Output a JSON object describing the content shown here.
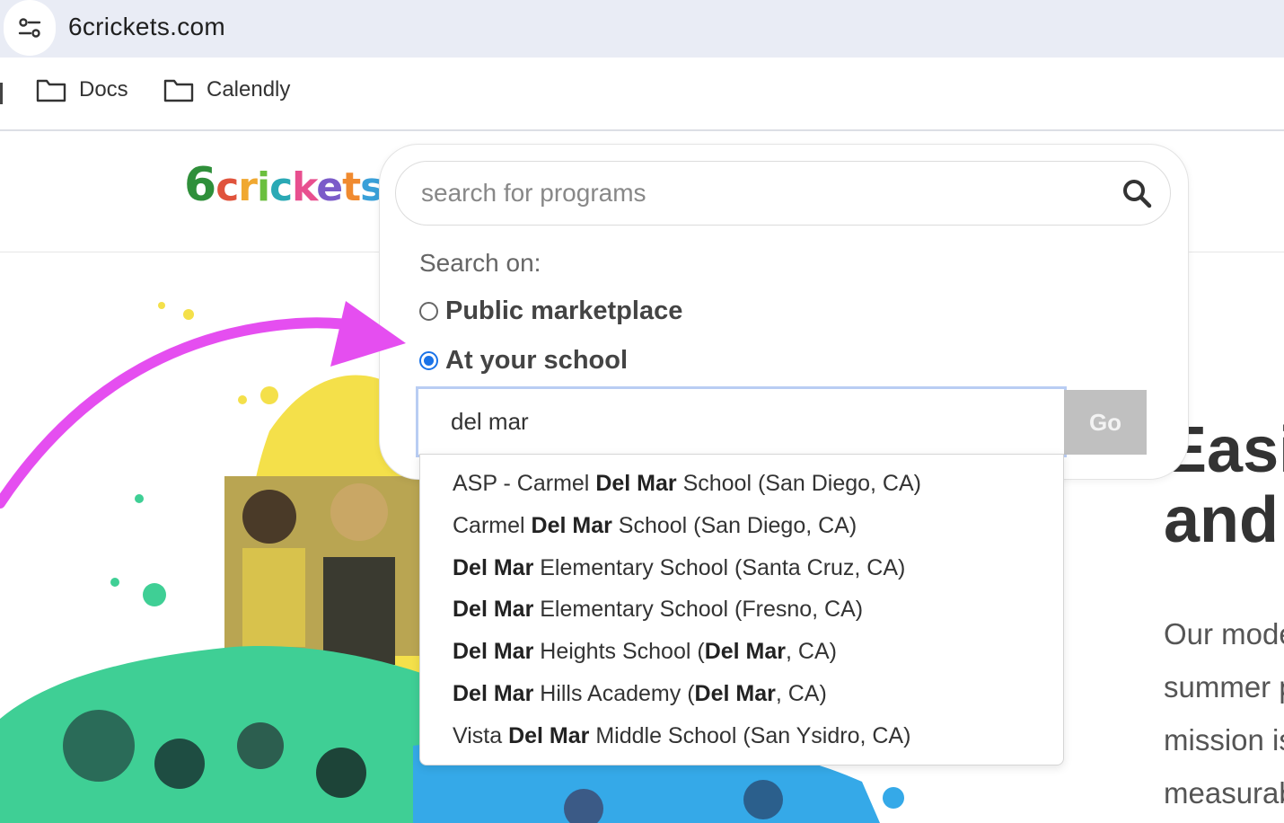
{
  "browser": {
    "url": "6crickets.com",
    "bookmarks": [
      {
        "label": "Docs"
      },
      {
        "label": "Calendly"
      }
    ]
  },
  "site": {
    "logo_text": "6crickets",
    "search": {
      "placeholder": "search for programs",
      "search_on_label": "Search on:",
      "options": [
        {
          "label": "Public marketplace",
          "checked": false
        },
        {
          "label": "At your school",
          "checked": true
        }
      ],
      "school_query": "del mar",
      "go_label": "Go",
      "suggestions": [
        {
          "pre": "ASP - Carmel ",
          "match": "Del Mar",
          "post": " School (San Diego, CA)",
          "match2": "",
          "post2": ""
        },
        {
          "pre": "Carmel ",
          "match": "Del Mar",
          "post": " School (San Diego, CA)",
          "match2": "",
          "post2": ""
        },
        {
          "pre": "",
          "match": "Del Mar",
          "post": " Elementary School (Santa Cruz, CA)",
          "match2": "",
          "post2": ""
        },
        {
          "pre": "",
          "match": "Del Mar",
          "post": " Elementary School (Fresno, CA)",
          "match2": "",
          "post2": ""
        },
        {
          "pre": "",
          "match": "Del Mar",
          "post": " Heights School (",
          "match2": "Del Mar",
          "post2": ", CA)"
        },
        {
          "pre": "",
          "match": "Del Mar",
          "post": " Hills Academy (",
          "match2": "Del Mar",
          "post2": ", CA)"
        },
        {
          "pre": "Vista ",
          "match": "Del Mar",
          "post": " Middle School (San Ysidro, CA)",
          "match2": "",
          "post2": ""
        }
      ]
    },
    "hero": {
      "heading_line1": "Easi",
      "heading_line2": "and",
      "para_lines": [
        "Our mode",
        "summer p",
        "mission is",
        "measurab"
      ]
    }
  },
  "colors": {
    "accent_arrow": "#e54ef0",
    "radio_accent": "#1a73e8",
    "go_button": "#c0c0c0"
  }
}
